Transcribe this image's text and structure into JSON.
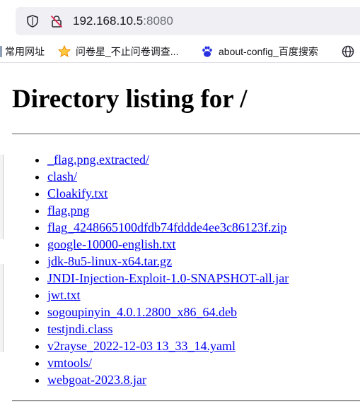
{
  "addressbar": {
    "host": "192.168.10.5",
    "port": ":8080"
  },
  "bookmarks": [
    {
      "label": "常用网址",
      "icon": "folder-icon"
    },
    {
      "label": "问卷星_不止问卷调查...",
      "icon": "star-icon"
    },
    {
      "label": "about-config_百度搜索",
      "icon": "baidu-paw-icon"
    },
    {
      "label": "",
      "icon": "globe-icon"
    }
  ],
  "page": {
    "title": "Directory listing for /",
    "files": [
      "_flag.png.extracted/",
      "clash/",
      "Cloakify.txt",
      "flag.png",
      "flag_4248665100dfdb74fddde4ee3c86123f.zip",
      "google-10000-english.txt",
      "jdk-8u5-linux-x64.tar.gz",
      "JNDI-Injection-Exploit-1.0-SNAPSHOT-all.jar",
      "jwt.txt",
      "sogoupinyin_4.0.1.2800_x86_64.deb",
      "testjndi.class",
      "v2rayse_2022-12-03 13_33_14.yaml",
      "vmtools/",
      "webgoat-2023.8.jar"
    ]
  }
}
